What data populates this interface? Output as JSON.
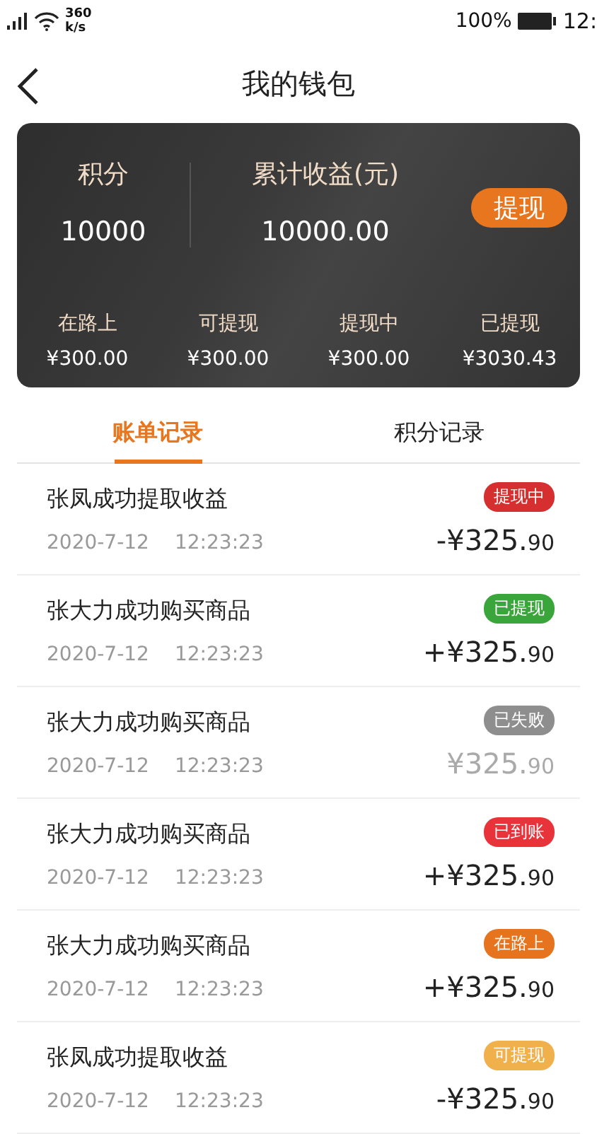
{
  "status_bar": {
    "speed": "360",
    "speed_unit": "k/s",
    "battery": "100%",
    "time": "12:"
  },
  "header": {
    "title": "我的钱包"
  },
  "summary": {
    "points_label": "积分",
    "points": "10000",
    "earnings_label": "累计收益(元)",
    "earnings": "10000.00",
    "withdraw_button": "提现",
    "stats": [
      {
        "label": "在路上",
        "value": "¥300.00"
      },
      {
        "label": "可提现",
        "value": "¥300.00"
      },
      {
        "label": "提现中",
        "value": "¥300.00"
      },
      {
        "label": "已提现",
        "value": "¥3030.43"
      }
    ]
  },
  "tabs": [
    {
      "label": "账单记录",
      "selected": true
    },
    {
      "label": "积分记录",
      "selected": false
    }
  ],
  "records": [
    {
      "title": "张凤成功提取收益",
      "date": "2020-7-12",
      "time": "12:23:23",
      "status": "提现中",
      "color": "#d62f2f",
      "sign": "-",
      "amount": "¥325.",
      "cents": "90",
      "muted": false
    },
    {
      "title": "张大力成功购买商品",
      "date": "2020-7-12",
      "time": "12:23:23",
      "status": "已提现",
      "color": "#3aa53a",
      "sign": "+",
      "amount": "¥325.",
      "cents": "90",
      "muted": false
    },
    {
      "title": "张大力成功购买商品",
      "date": "2020-7-12",
      "time": "12:23:23",
      "status": "已失败",
      "color": "#8e8e8e",
      "amount": "¥325.",
      "cents": "90",
      "muted": true
    },
    {
      "title": "张大力成功购买商品",
      "date": "2020-7-12",
      "time": "12:23:23",
      "status": "已到账",
      "color": "#e8333a",
      "sign": "+",
      "amount": "¥325.",
      "cents": "90",
      "muted": false
    },
    {
      "title": "张大力成功购买商品",
      "date": "2020-7-12",
      "time": "12:23:23",
      "status": "在路上",
      "color": "#e6741e",
      "sign": "+",
      "amount": "¥325.",
      "cents": "90",
      "muted": false
    },
    {
      "title": "张凤成功提取收益",
      "date": "2020-7-12",
      "time": "12:23:23",
      "status": "可提现",
      "color": "#f0b04c",
      "sign": "-",
      "amount": "¥325.",
      "cents": "90",
      "muted": false
    }
  ]
}
